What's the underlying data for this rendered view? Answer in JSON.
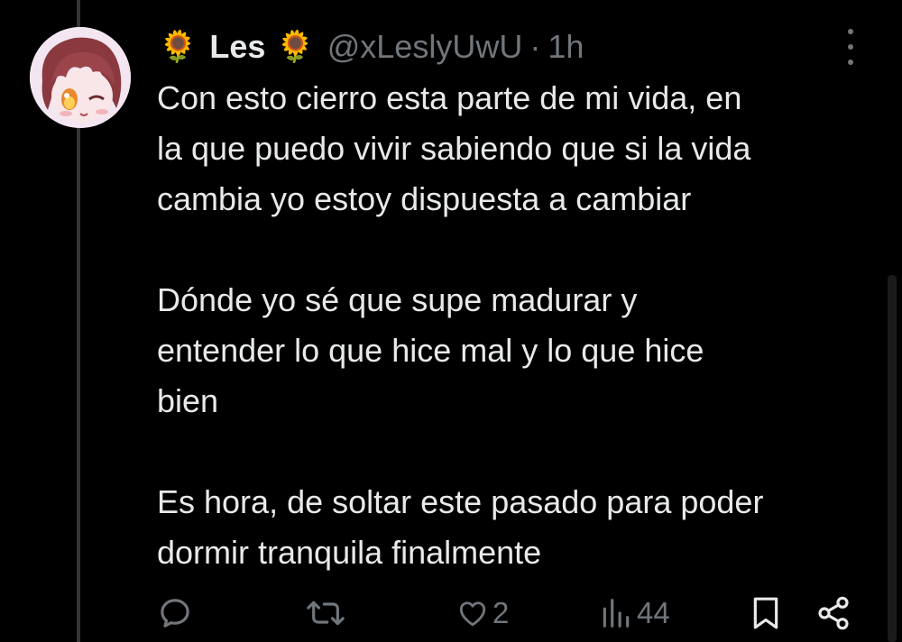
{
  "tweet": {
    "author": {
      "display_name": "Les",
      "emoji_left": "🌻",
      "emoji_right": "🌻",
      "handle": "@xLeslyUwU",
      "separator": "·",
      "time": "1h"
    },
    "paragraphs": [
      [
        "Con esto cierro esta parte de mi vida, en",
        "la que puedo vivir sabiendo que si la vida",
        "cambia yo estoy dispuesta a cambiar"
      ],
      [
        "Dónde yo sé que supe madurar y",
        "entender lo que hice mal y lo que hice",
        "bien"
      ],
      [
        "Es hora, de soltar este pasado para poder",
        "dormir tranquila finalmente"
      ]
    ],
    "actions": {
      "reply": {
        "icon": "reply-icon",
        "count": ""
      },
      "retweet": {
        "icon": "retweet-icon",
        "count": ""
      },
      "like": {
        "icon": "heart-icon",
        "count": "2"
      },
      "views": {
        "icon": "views-chart-icon",
        "count": "44"
      },
      "bookmark": {
        "icon": "bookmark-icon"
      },
      "share": {
        "icon": "share-icon"
      }
    }
  },
  "colors": {
    "background": "#000000",
    "primary_text": "#e7e9ea",
    "secondary_text": "#71767b",
    "thread_line": "#333639"
  }
}
